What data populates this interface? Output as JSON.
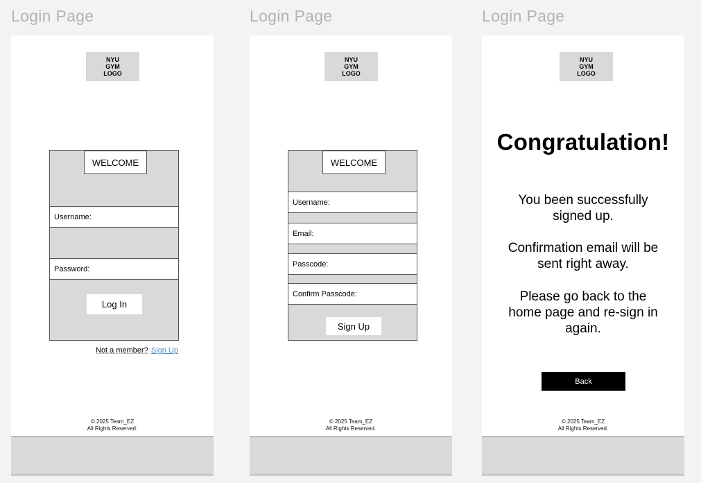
{
  "frames": [
    {
      "title": "Login Page",
      "logo": "NYU GYM LOGO",
      "welcome": "WELCOME",
      "username_label": "Username:",
      "password_label": "Password:",
      "login_button": "Log In",
      "not_member": "Not a member?",
      "signup_link": "Sign Up",
      "footer_copyright": "© 2025 Team_EZ",
      "footer_rights": "All Rights Reserved."
    },
    {
      "title": "Login Page",
      "logo": "NYU GYM LOGO",
      "welcome": "WELCOME",
      "username_label": "Username:",
      "email_label": "Email:",
      "passcode_label": "Passcode:",
      "confirm_label": "Confirm Passcode:",
      "signup_button": "Sign Up",
      "footer_copyright": "© 2025 Team_EZ",
      "footer_rights": "All Rights Reserved."
    },
    {
      "title": "Login Page",
      "logo": "NYU GYM LOGO",
      "heading": "Congratulation!",
      "message_1": "You been successfully signed up.",
      "message_2": "Confirmation email will be sent right away.",
      "message_3": "Please go back to the home page and re-sign in again.",
      "back_button": "Back",
      "footer_copyright": "© 2025 Team_EZ",
      "footer_rights": "All Rights Reserved."
    }
  ]
}
